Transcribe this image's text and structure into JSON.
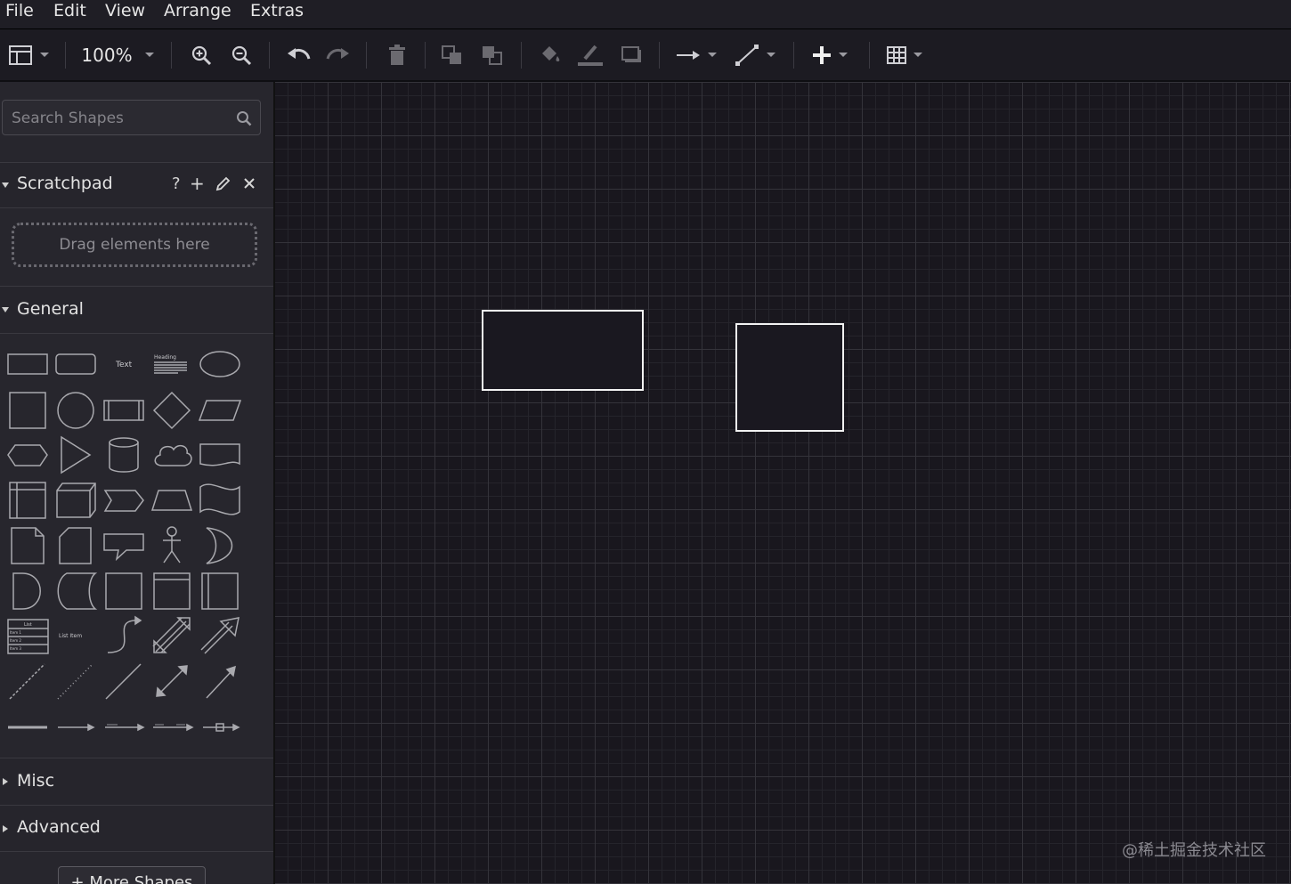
{
  "menu": {
    "file": "File",
    "edit": "Edit",
    "view": "View",
    "arrange": "Arrange",
    "extras": "Extras"
  },
  "toolbar": {
    "zoom": "100%",
    "icons": [
      "panel-layout-icon",
      "zoom-in-icon",
      "zoom-out-icon",
      "undo-icon",
      "redo-icon",
      "delete-icon",
      "to-front-icon",
      "to-back-icon",
      "fill-color-icon",
      "line-color-icon",
      "shadow-icon",
      "connection-icon",
      "waypoints-icon",
      "insert-plus-icon",
      "table-icon"
    ]
  },
  "sidebar": {
    "search_placeholder": "Search Shapes",
    "scratchpad": {
      "title": "Scratchpad",
      "help": "?",
      "add": "+",
      "drop_hint": "Drag elements here"
    },
    "general": {
      "title": "General",
      "text_shape_label": "Text",
      "heading_shape_label": "Heading",
      "list_label": "List",
      "list_items": [
        "Item 1",
        "Item 2",
        "Item 3"
      ],
      "list_item_label": "List Item"
    },
    "misc": {
      "title": "Misc"
    },
    "advanced": {
      "title": "Advanced"
    },
    "more_shapes": "+ More Shapes"
  },
  "watermark": "@稀土掘金技术社区",
  "colors": {
    "background": "#1c1b22",
    "canvas": "#19171e",
    "shape_stroke": "#f2f2f2"
  }
}
